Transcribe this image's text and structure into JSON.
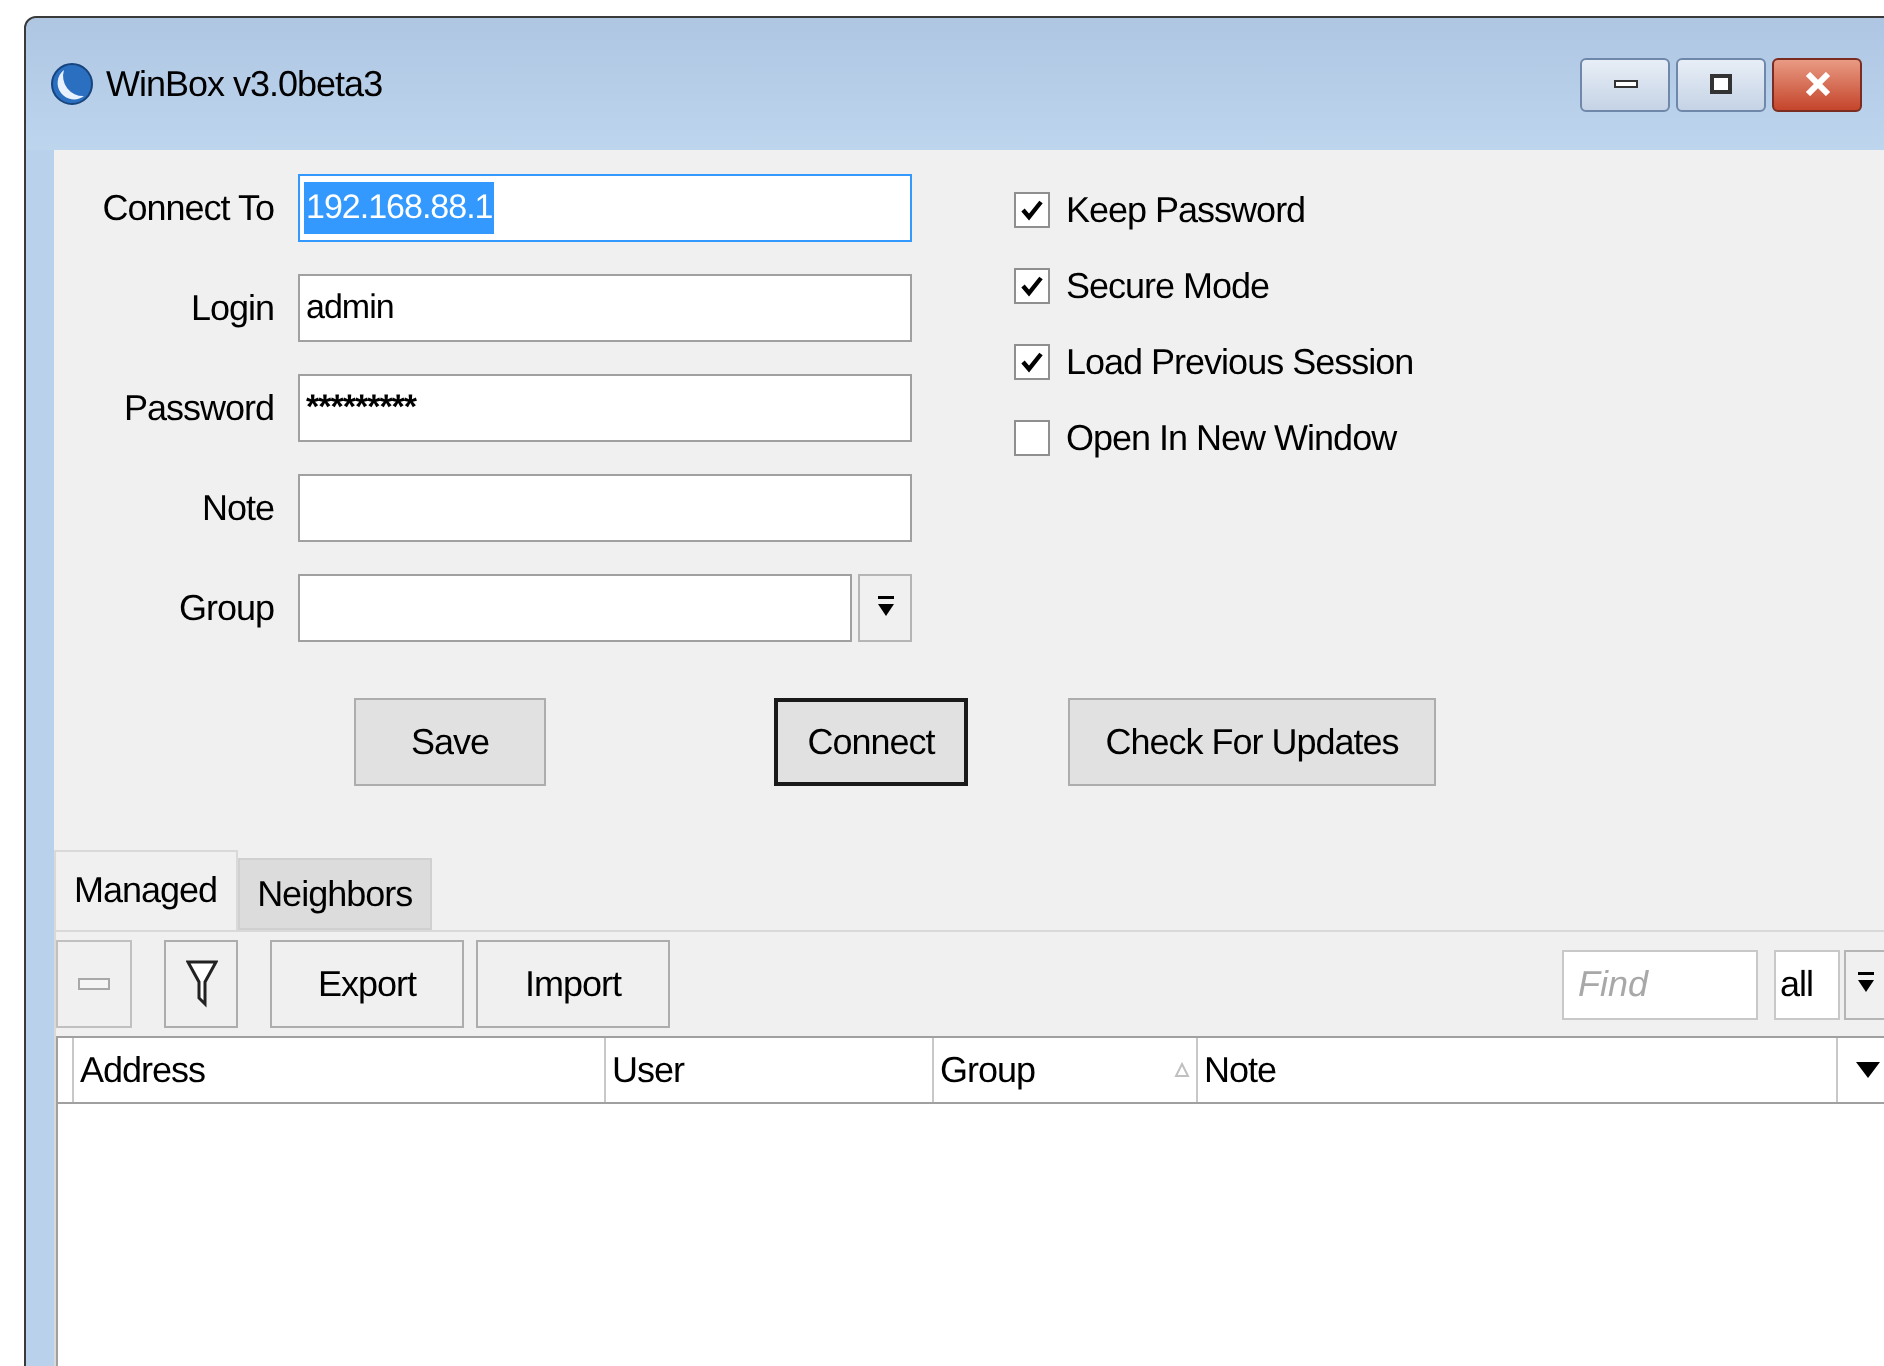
{
  "window": {
    "title": "WinBox v3.0beta3"
  },
  "form": {
    "fields": [
      {
        "label": "Connect To",
        "kind": "text",
        "value": "192.168.88.1",
        "text_selected": true
      },
      {
        "label": "Login",
        "kind": "text",
        "value": "admin",
        "text_selected": false
      },
      {
        "label": "Password",
        "kind": "password",
        "value": "*********",
        "text_selected": false
      },
      {
        "label": "Note",
        "kind": "text",
        "text_selected": false
      },
      {
        "label": "Group",
        "kind": "select",
        "text_selected": false
      }
    ],
    "options": [
      {
        "label": "Keep Password",
        "checked": true
      },
      {
        "label": "Secure Mode",
        "checked": true
      },
      {
        "label": "Load Previous Session",
        "checked": true
      },
      {
        "label": "Open In New Window",
        "checked": false
      }
    ],
    "buttons": [
      {
        "label": "Save",
        "default": false
      },
      {
        "label": "Connect",
        "default": true
      },
      {
        "label": "Check For Updates",
        "default": false
      }
    ]
  },
  "tabs": [
    {
      "label": "Managed",
      "selected": true
    },
    {
      "label": "Neighbors",
      "selected": false
    }
  ],
  "toolbar": {
    "buttons": [
      {
        "kind": "remove",
        "disabled": true
      },
      {
        "kind": "filter",
        "disabled": false
      },
      {
        "kind": "text",
        "label": "Export",
        "disabled": false
      },
      {
        "kind": "text",
        "label": "Import",
        "disabled": false
      }
    ],
    "find": {
      "placeholder": "Find"
    },
    "filter_value": "all"
  },
  "table": {
    "columns": [
      {
        "label": "Address",
        "sorted": false
      },
      {
        "label": "User",
        "sorted": false
      },
      {
        "label": "Group",
        "sorted": true
      },
      {
        "label": "Note",
        "sorted": false
      }
    ]
  }
}
